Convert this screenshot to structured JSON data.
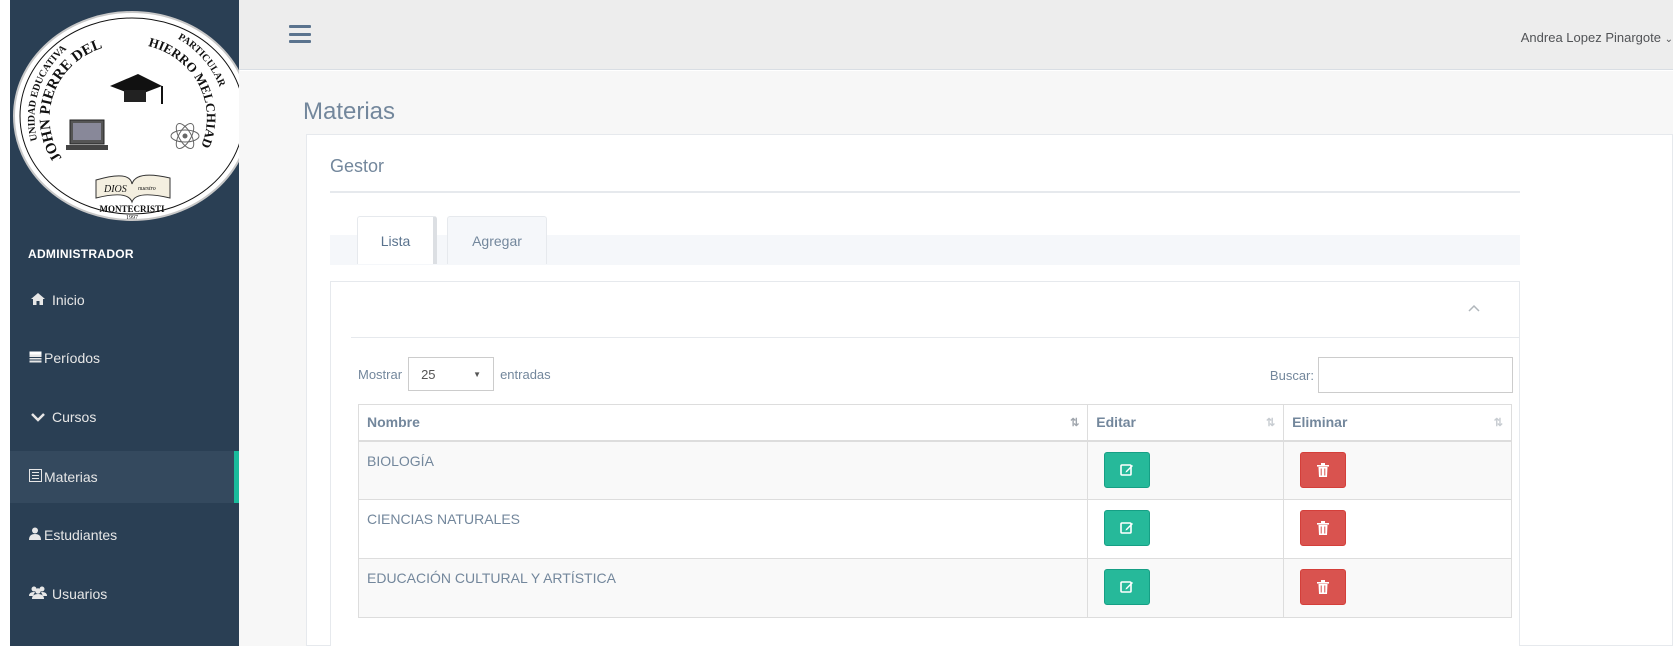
{
  "logo": {
    "school_type": "UNIDAD EDUCATIVA",
    "school_name": "JOHN PIERRE DEL HIERRO MELCHIADE",
    "particular": "PARTICULAR",
    "city": "MONTECRISTI",
    "year": "1997",
    "motto": "DIOS es nuestro guia"
  },
  "sidebar": {
    "role": "ADMINISTRADOR",
    "items": [
      {
        "label": "Inicio",
        "icon": "home-icon"
      },
      {
        "label": "Períodos",
        "icon": "calendar-icon"
      },
      {
        "label": "Cursos",
        "icon": "chevron-down-icon"
      },
      {
        "label": "Materias",
        "icon": "list-alt-icon",
        "active": true
      },
      {
        "label": "Estudiantes",
        "icon": "user-icon"
      },
      {
        "label": "Usuarios",
        "icon": "users-icon"
      }
    ]
  },
  "topnav": {
    "user_name": "Andrea Lopez Pinargote",
    "user_caret": "⌄"
  },
  "page": {
    "title": "Materias",
    "panel_title": "Gestor",
    "tabs": [
      "Lista",
      "Agregar"
    ],
    "active_tab": "Lista"
  },
  "table": {
    "length_prefix": "Mostrar",
    "length_value": "25",
    "length_suffix": "entradas",
    "search_label": "Buscar:",
    "search_value": "",
    "columns": [
      "Nombre",
      "Editar",
      "Eliminar"
    ],
    "rows": [
      {
        "nombre": "BIOLOGÍA"
      },
      {
        "nombre": "CIENCIAS NATURALES"
      },
      {
        "nombre": "EDUCACIÓN CULTURAL Y ARTÍSTICA"
      }
    ]
  },
  "colors": {
    "sidebar_bg": "#2a3f54",
    "active_indicator": "#1abb9c",
    "edit_button": "#26b99a",
    "delete_button": "#d9534f"
  }
}
